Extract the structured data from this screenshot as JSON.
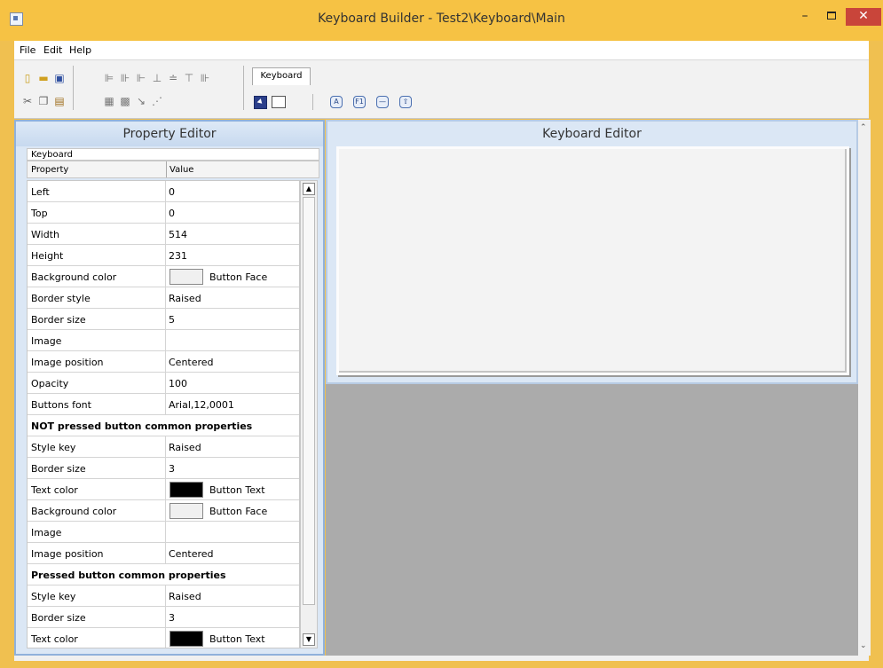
{
  "window": {
    "title": "Keyboard Builder - Test2\\Keyboard\\Main",
    "min": "–",
    "close": "✕"
  },
  "menu": [
    "File",
    "Edit",
    "Help"
  ],
  "toolbar": {
    "tab_label": "Keyboard",
    "icons_row1": [
      "new-file-icon",
      "open-folder-icon",
      "save-icon",
      "align-left-icon",
      "align-center-icon",
      "align-right-icon",
      "align-top-icon",
      "align-middle-icon",
      "align-bottom-icon"
    ],
    "icons_row2": [
      "cut-icon",
      "copy-icon",
      "paste-icon",
      "same-width-icon",
      "same-height-icon",
      "distribute-icon",
      "grid-icon"
    ],
    "key_tools": [
      "A",
      "F1",
      "—",
      "⇧"
    ]
  },
  "property_editor": {
    "title": "Property Editor",
    "object": "Keyboard",
    "header_property": "Property",
    "header_value": "Value",
    "rows": [
      {
        "k": "Left",
        "v": "0"
      },
      {
        "k": "Top",
        "v": "0"
      },
      {
        "k": "Width",
        "v": "514"
      },
      {
        "k": "Height",
        "v": "231"
      },
      {
        "k": "Background color",
        "v": "Button Face",
        "swatch": "#f0f0f0"
      },
      {
        "k": "Border style",
        "v": "Raised"
      },
      {
        "k": "Border size",
        "v": "5"
      },
      {
        "k": "Image",
        "v": ""
      },
      {
        "k": "Image position",
        "v": "Centered"
      },
      {
        "k": "Opacity",
        "v": "100"
      },
      {
        "k": "Buttons font",
        "v": "Arial,12,0001"
      },
      {
        "k": "NOT pressed button common properties",
        "v": "",
        "section": true
      },
      {
        "k": "Style key",
        "v": "Raised"
      },
      {
        "k": "Border size",
        "v": "3"
      },
      {
        "k": "Text color",
        "v": "Button Text",
        "swatch": "#000000"
      },
      {
        "k": "Background color",
        "v": "Button Face",
        "swatch": "#f0f0f0"
      },
      {
        "k": "Image",
        "v": ""
      },
      {
        "k": "Image position",
        "v": "Centered"
      },
      {
        "k": "Pressed button common properties",
        "v": "",
        "section": true
      },
      {
        "k": "Style key",
        "v": "Raised"
      },
      {
        "k": "Border size",
        "v": "3"
      },
      {
        "k": "Text color",
        "v": "Button Text",
        "swatch": "#000000"
      }
    ]
  },
  "keyboard_editor": {
    "title": "Keyboard Editor"
  }
}
